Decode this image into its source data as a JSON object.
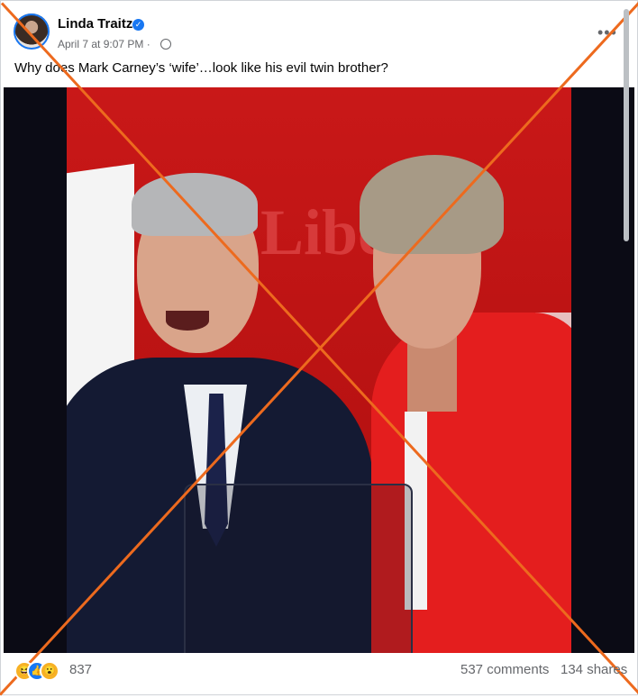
{
  "post": {
    "author": "Linda Traitz",
    "timestamp": "April 7 at 9:07 PM",
    "caption": "Why does Mark Carney’s ‘wife’…look like his evil twin brother?"
  },
  "image": {
    "backdrop_text": "Libe",
    "overlay_color": "#ed6a1e"
  },
  "footer": {
    "reactions": [
      "haha",
      "like",
      "wow"
    ],
    "reaction_count": "837",
    "comments": "537 comments",
    "shares": "134 shares"
  },
  "icons": {
    "verified": "verified-badge-icon",
    "privacy": "globe-icon",
    "more": "more-options-icon"
  }
}
